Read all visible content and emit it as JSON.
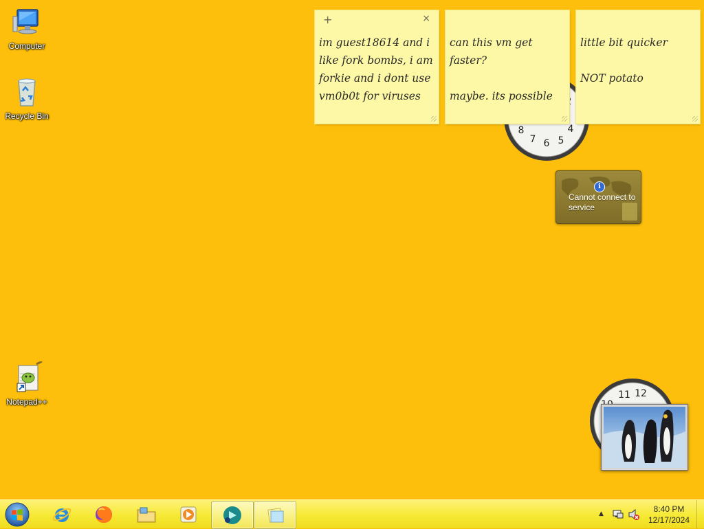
{
  "desktop": {
    "background": "#fdbf0b",
    "icons": [
      {
        "label": "Computer",
        "icon": "computer-icon"
      },
      {
        "label": "Recycle Bin",
        "icon": "recycle-bin-icon"
      },
      {
        "label": "Notepad++",
        "icon": "notepad-plus-plus-icon"
      }
    ]
  },
  "sticky_notes": [
    {
      "text": "im guest18614 and i like fork bombs, i am forkie and i dont use vm0b0t for viruses",
      "new_label": "+",
      "close_label": "×"
    },
    {
      "text": "can this vm get faster?\n\nmaybe. its possible"
    },
    {
      "text": "little bit quicker\n\nNOT potato"
    }
  ],
  "weather_gadget": {
    "message": "Cannot connect to service",
    "info_icon": "info-icon"
  },
  "taskbar": {
    "start_icon": "windows-start-orb-icon",
    "buttons": [
      {
        "name": "internet-explorer",
        "icon": "internet-explorer-icon",
        "active": false
      },
      {
        "name": "firefox",
        "icon": "firefox-icon",
        "active": false
      },
      {
        "name": "file-explorer",
        "icon": "folder-icon",
        "active": false
      },
      {
        "name": "media-player",
        "icon": "media-player-icon",
        "active": false
      },
      {
        "name": "running-app",
        "icon": "app-icon",
        "active": true
      },
      {
        "name": "sticky-notes",
        "icon": "sticky-notes-icon",
        "active": true
      }
    ],
    "tray": {
      "show_hidden_label": "▲",
      "time": "8:40 PM",
      "date": "12/17/2024"
    }
  },
  "colors": {
    "note": "#fdf8a5",
    "taskbar": "#f6e934"
  }
}
